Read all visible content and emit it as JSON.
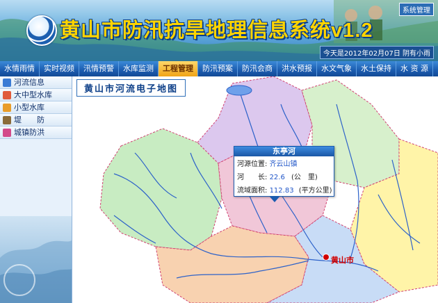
{
  "header": {
    "app_title": "黄山市防汛抗旱地理信息系统v1.2",
    "sys_button": "系统管理",
    "weather": "今天是2012年02月07日  阴有小雨"
  },
  "nav": {
    "items": [
      "水情雨情",
      "实时视频",
      "汛情预警",
      "水库监测",
      "工程管理",
      "防汛预案",
      "防汛会商",
      "洪水预报",
      "水文气象",
      "水土保持",
      "水 资 源"
    ],
    "active_index": 4
  },
  "sidebar": {
    "items": [
      "河流信息",
      "大中型水库",
      "小型水库",
      "堤　　防",
      "城镇防洪"
    ]
  },
  "map": {
    "title": "黄山市河流电子地图",
    "city": "黄山市",
    "popup": {
      "title": "东亭河",
      "source_label": "河源位置:",
      "source_value": "齐云山镇",
      "length_label": "河　　长:",
      "length_value": "22.6",
      "length_unit": "(公　里)",
      "area_label": "流域面积:",
      "area_value": "112.83",
      "area_unit": "(平方公里)"
    }
  },
  "colors": {
    "nav_bg": "#1b5cb0",
    "nav_active": "#f0a418",
    "title_yellow": "#ffd400",
    "popup_value": "#1f55c8",
    "region_green": "#c8ecc2",
    "region_purple": "#dcc8ee",
    "region_pink": "#f1c7d8",
    "region_yellow": "#fff4a8",
    "region_orange": "#f8d2b0",
    "region_blue": "#c8dcf6",
    "river": "#2d62c9"
  }
}
